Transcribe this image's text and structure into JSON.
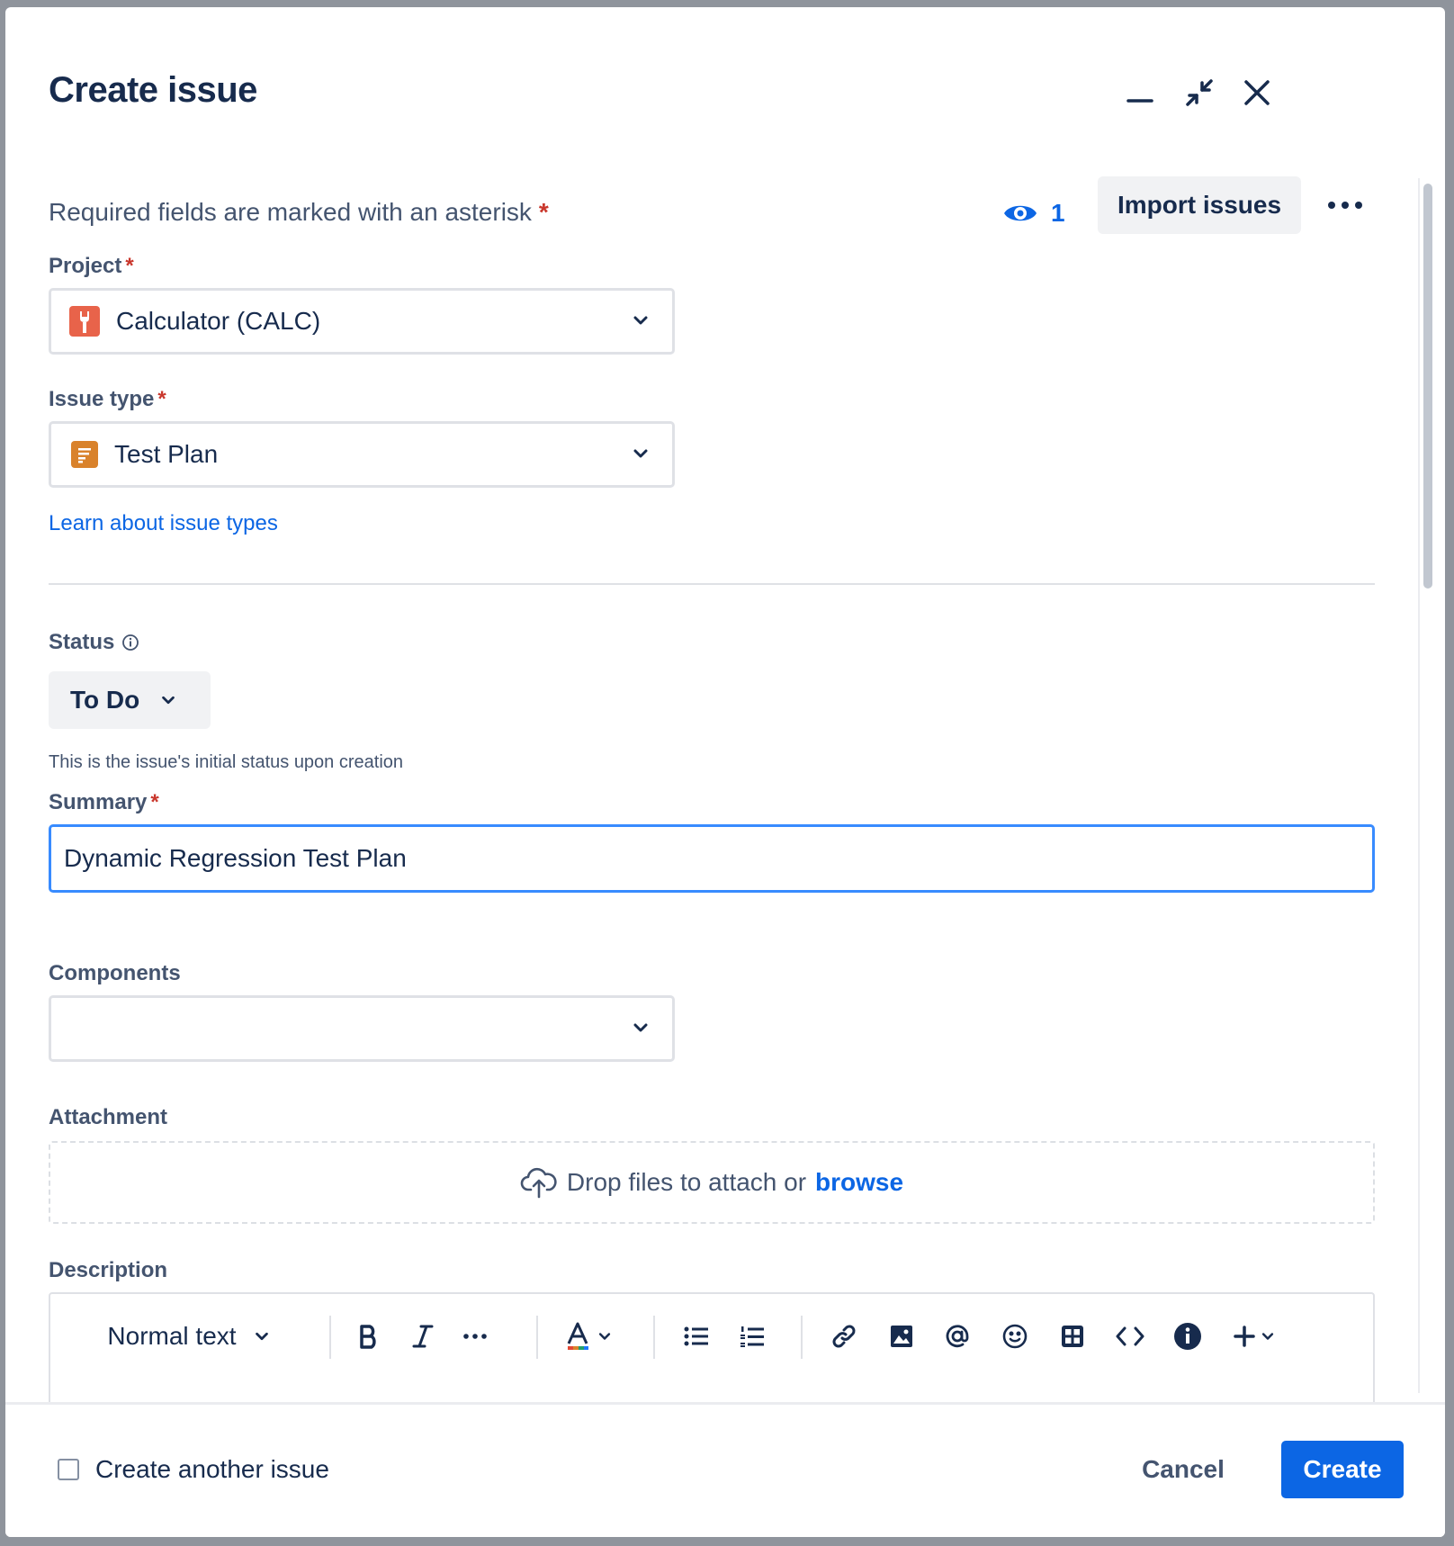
{
  "dialog": {
    "title": "Create issue",
    "required_note": "Required fields are marked with an asterisk",
    "asterisk": "*"
  },
  "watch": {
    "count": "1"
  },
  "actions": {
    "import_label": "Import issues"
  },
  "fields": {
    "project": {
      "label": "Project",
      "value": "Calculator (CALC)"
    },
    "issue_type": {
      "label": "Issue type",
      "value": "Test Plan",
      "learn_link": "Learn about issue types"
    },
    "status": {
      "label": "Status",
      "value": "To Do",
      "helper": "This is the issue's initial status upon creation"
    },
    "summary": {
      "label": "Summary",
      "value": "Dynamic Regression Test Plan"
    },
    "components": {
      "label": "Components",
      "value": ""
    },
    "attachment": {
      "label": "Attachment",
      "drop_text": "Drop files to attach or",
      "browse_label": "browse"
    },
    "description": {
      "label": "Description",
      "text_style": "Normal text"
    }
  },
  "footer": {
    "create_another_label": "Create another issue",
    "cancel_label": "Cancel",
    "create_label": "Create"
  },
  "colors": {
    "primary": "#0C66E4",
    "required": "#C9372C",
    "project_icon": "#E8634A",
    "issue_type_icon": "#D9822B"
  }
}
